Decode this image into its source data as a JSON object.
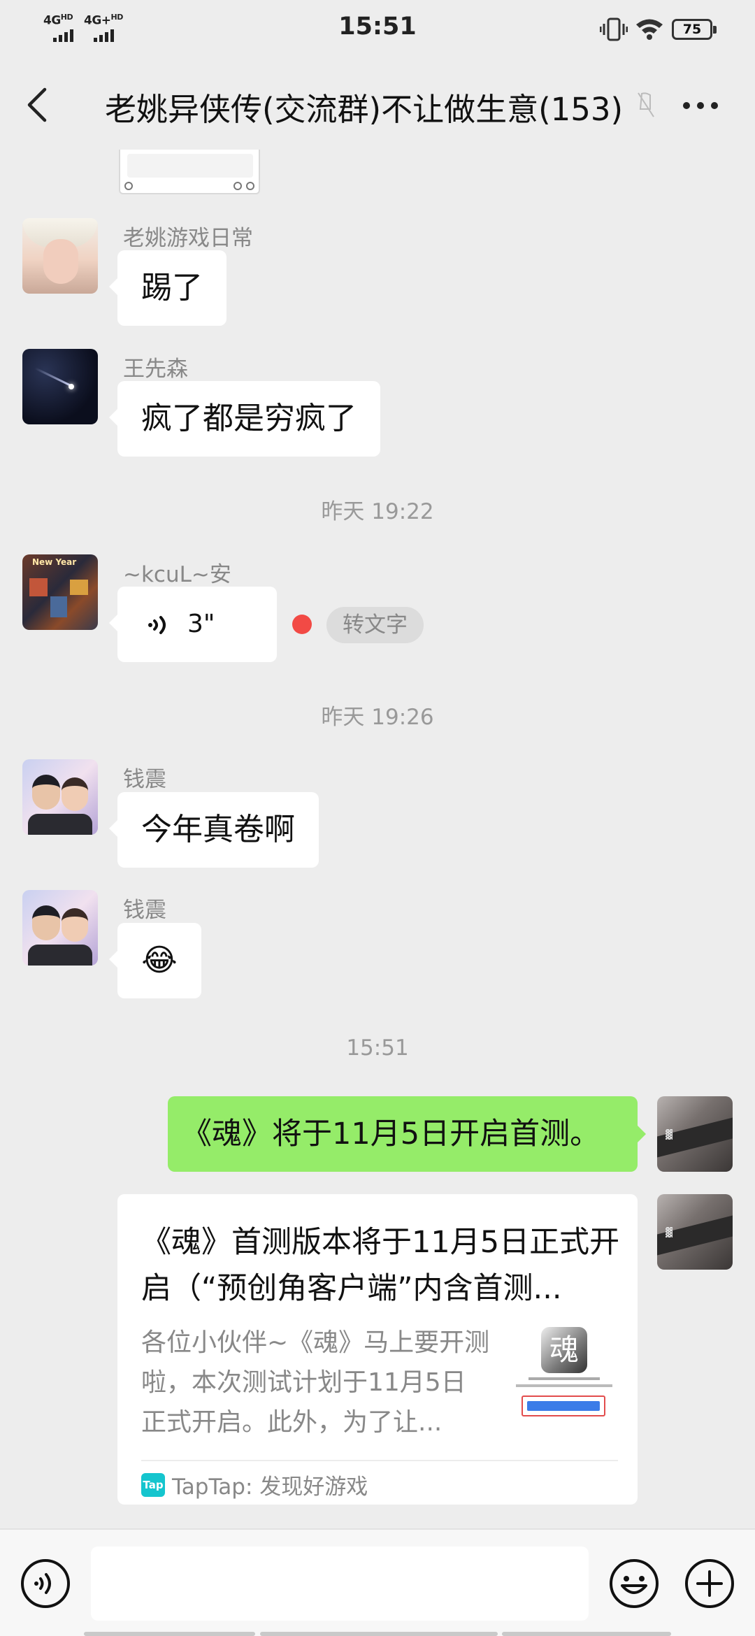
{
  "status_bar": {
    "network_1": "4G",
    "network_1_sup": "HD",
    "network_2": "4G+",
    "network_2_sup": "HD",
    "time": "15:51",
    "battery": "75",
    "icons": [
      "vibrate-icon",
      "wifi-icon",
      "battery-icon"
    ]
  },
  "header": {
    "title": "老姚异侠传(交流群)不让做生意(153)",
    "icons": [
      "back-icon",
      "mute-icon",
      "more-icon"
    ]
  },
  "messages": {
    "m1": {
      "sender": "老姚游戏日常",
      "text": "踢了"
    },
    "m2": {
      "sender": "王先森",
      "text": "疯了都是穷疯了"
    },
    "t1": "昨天 19:22",
    "m3": {
      "sender": "~kcuL~安",
      "duration": "3\"",
      "avatar_text": "New Year",
      "to_text": "转文字"
    },
    "t2": "昨天 19:26",
    "m4": {
      "sender": "钱震",
      "text": "今年真卷啊"
    },
    "m5": {
      "sender": "钱震",
      "text": "😂"
    },
    "t3": "15:51",
    "m6": {
      "text": "《魂》将于11月5日开启首测。"
    },
    "m7": {
      "title": "《魂》首测版本将于11月5日正式开启（“预创角客户端”内含首测...",
      "description": "各位小伙伴~《魂》马上要开测啦，本次测试计划于11月5日正式开启。此外，为了让...",
      "source": "TapTap: 发现好游戏",
      "logo_text": "Tap",
      "thumb_logo": "魂"
    }
  },
  "composer": {
    "icons": [
      "voice-icon",
      "emoji-icon",
      "plus-icon"
    ]
  },
  "colors": {
    "background": "#ededed",
    "bubble_self": "#95ec69",
    "bubble_other": "#ffffff",
    "record_dot": "#f24a45",
    "taptap": "#15c5ce"
  }
}
